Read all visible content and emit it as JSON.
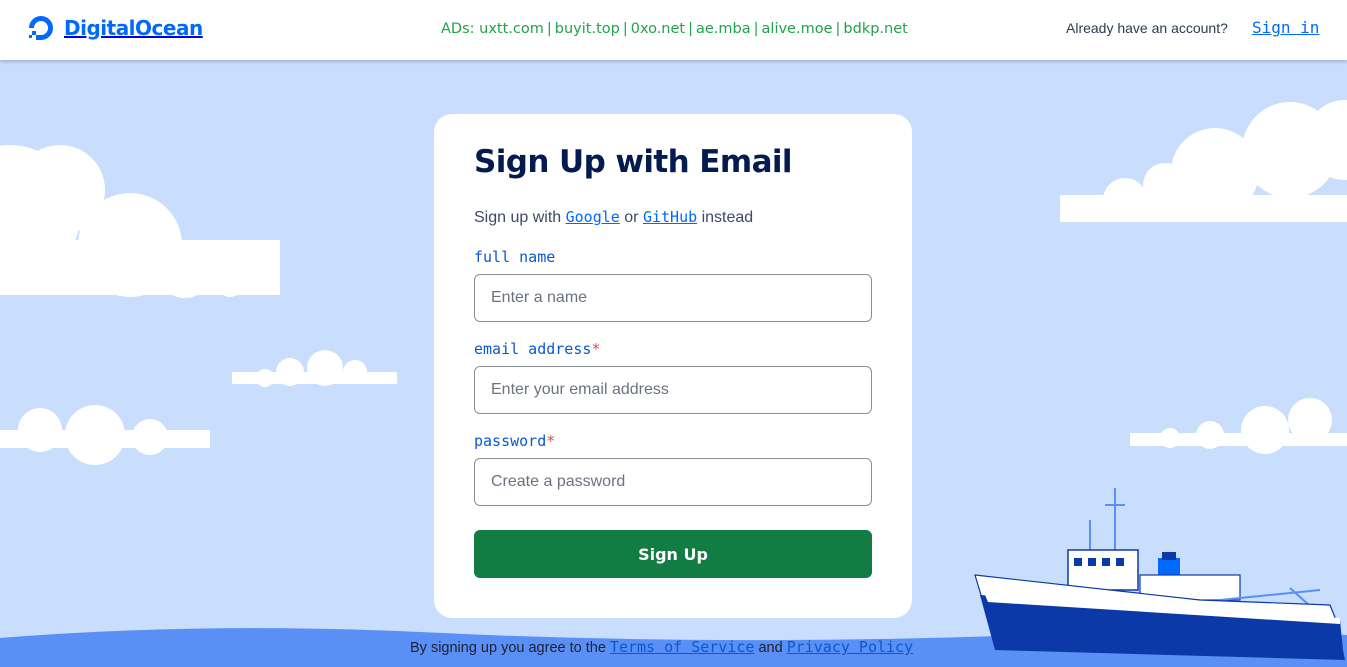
{
  "brand": {
    "name": "DigitalOcean",
    "color": "#0069ff"
  },
  "ads": {
    "prefix": "ADs:",
    "items": [
      "uxtt.com",
      "buyit.top",
      "0xo.net",
      "ae.mba",
      "alive.moe",
      "bdkp.net"
    ],
    "color": "#20a34a"
  },
  "header": {
    "account_prompt": "Already have an account?",
    "signin_label": "Sign in"
  },
  "form": {
    "title": "Sign Up with Email",
    "alt_prefix": "Sign up with",
    "google_label": "Google",
    "alt_or": "or",
    "github_label": "GitHub",
    "alt_suffix": "instead",
    "fields": {
      "name": {
        "label": "full name",
        "required": false,
        "placeholder": "Enter a name",
        "value": ""
      },
      "email": {
        "label": "email address",
        "required": true,
        "placeholder": "Enter your email address",
        "value": ""
      },
      "password": {
        "label": "password",
        "required": true,
        "placeholder": "Create a password",
        "value": ""
      }
    },
    "required_mark": "*",
    "submit_label": "Sign Up",
    "submit_color": "#137c43"
  },
  "footer": {
    "prefix": "By signing up you agree to the",
    "terms_label": "Terms of Service",
    "and": "and",
    "privacy_label": "Privacy Policy"
  },
  "colors": {
    "sky": "#c9defc",
    "sea": "#5a8ff5",
    "cloud": "#ffffff"
  }
}
